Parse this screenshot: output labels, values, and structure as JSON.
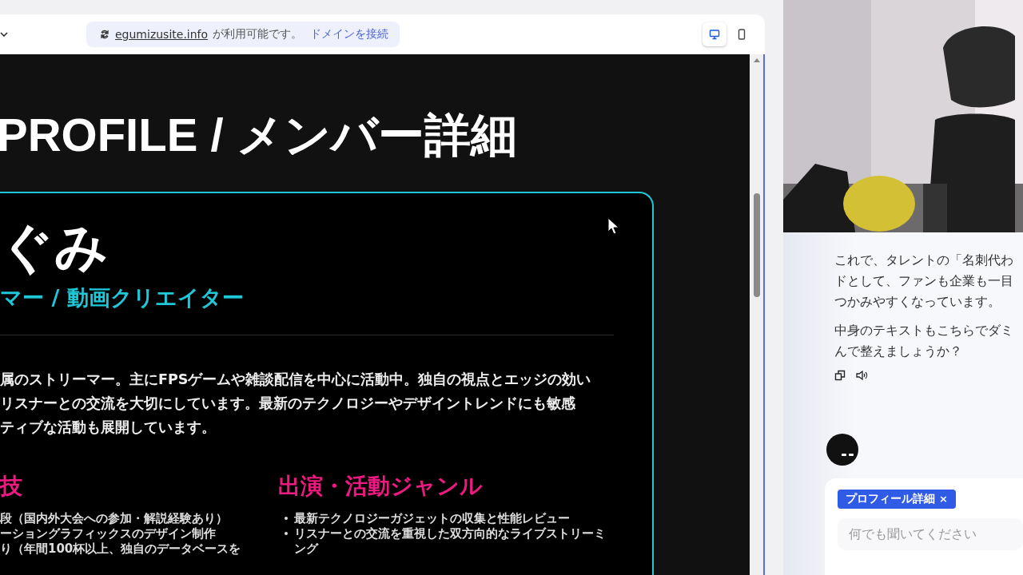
{
  "toolbar": {
    "banner": {
      "domain": "egumizusite.info",
      "message": "が利用可能です。",
      "action": "ドメインを接続"
    },
    "view_modes": [
      {
        "kind": "desktop",
        "selected": true
      },
      {
        "kind": "mobile",
        "selected": false
      }
    ]
  },
  "page": {
    "heading": "PROFILE / メンバー詳細",
    "profile": {
      "name": "ぐみ",
      "role": "マー / 動画クリエイター",
      "bio_lines": [
        "属のストリーマー。主にFPSゲームや雑談配信を中心に活動中。独自の視点とエッジの効い",
        "リスナーとの交流を大切にしています。最新のテクノロジーやデザイントレンドにも敏感",
        "ティブな活動も展開しています。"
      ],
      "sections": [
        {
          "title": "技",
          "bulleted": false,
          "items": [
            "段（国内外大会への参加・解説経験あり）",
            "ーショングラフィックスのデザイン制作",
            "り（年間100杯以上、独自のデータベースを"
          ]
        },
        {
          "title": "出演・活動ジャンル",
          "bulleted": true,
          "items": [
            "最新テクノロジーガジェットの収集と性能レビュー",
            "リスナーとの交流を重視した双方向的なライブストリーミング"
          ]
        }
      ]
    }
  },
  "chat": {
    "messages": [
      {
        "lines": [
          "これで、タレントの「名刺代わ",
          "ドとして、ファンも企業も一目",
          "つかみやすくなっています。"
        ]
      },
      {
        "lines": [
          "中身のテキストもこちらでダミ",
          "んで整えましょうか？"
        ]
      }
    ],
    "context_chip": {
      "label": "プロフィール詳細",
      "close": "×"
    },
    "input": {
      "placeholder": "何でも聞いてください"
    }
  }
}
